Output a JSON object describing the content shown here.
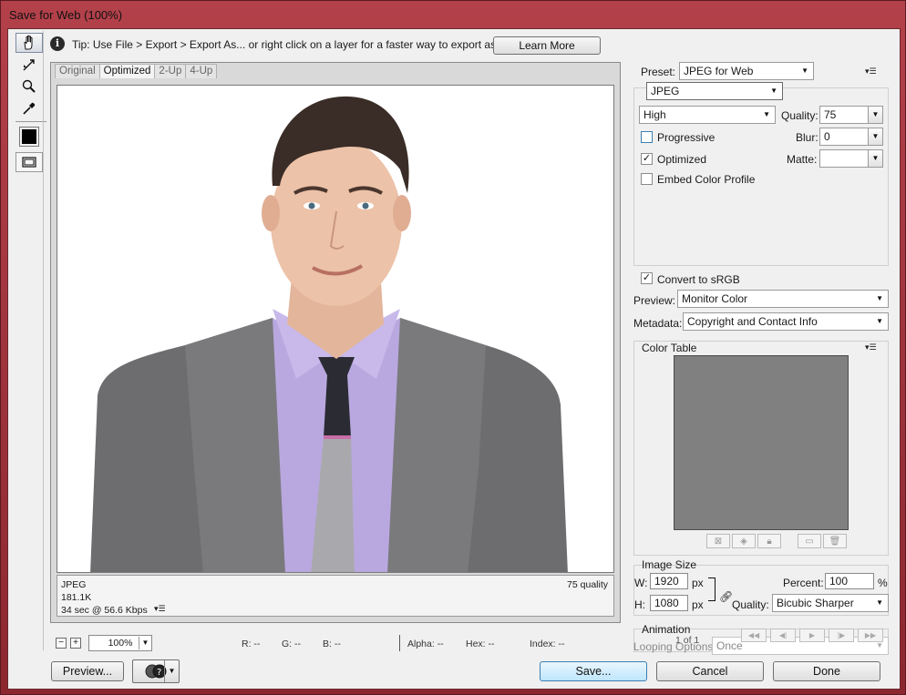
{
  "window": {
    "title": "Save for Web (100%)"
  },
  "tools": [
    {
      "name": "hand-tool",
      "icon": "hand-icon"
    },
    {
      "name": "slice-select-tool",
      "icon": "slice-select-icon"
    },
    {
      "name": "zoom-tool",
      "icon": "magnifier-icon"
    },
    {
      "name": "eyedropper-tool",
      "icon": "eyedropper-icon"
    },
    {
      "name": "toggle-slices",
      "icon": "slices-icon"
    }
  ],
  "tip": {
    "text": "Tip: Use File > Export > Export As...  or right click on a layer for a faster way to export assets",
    "learn_more": "Learn More"
  },
  "tabs": [
    "Original",
    "Optimized",
    "2-Up",
    "4-Up"
  ],
  "active_tab": "Optimized",
  "preview_info": {
    "format": "JPEG",
    "size": "181.1K",
    "download": "34 sec @ 56.6 Kbps",
    "quality": "75 quality"
  },
  "status": {
    "zoom": "100%",
    "r": "R: --",
    "g": "G: --",
    "b": "B: --",
    "alpha": "Alpha: --",
    "hex": "Hex: --",
    "index": "Index: --"
  },
  "buttons": {
    "preview": "Preview...",
    "save": "Save...",
    "cancel": "Cancel",
    "done": "Done"
  },
  "settings": {
    "preset_label": "Preset:",
    "preset_value": "JPEG for Web",
    "format": "JPEG",
    "quality_level": "High",
    "quality_label": "Quality:",
    "quality_value": "75",
    "progressive_label": "Progressive",
    "progressive_checked": false,
    "blur_label": "Blur:",
    "blur_value": "0",
    "optimized_label": "Optimized",
    "optimized_checked": true,
    "matte_label": "Matte:",
    "matte_value": "",
    "embed_profile_label": "Embed Color Profile",
    "embed_profile_checked": false,
    "convert_srgb_label": "Convert to sRGB",
    "convert_srgb_checked": true,
    "preview_label": "Preview:",
    "preview_value": "Monitor Color",
    "metadata_label": "Metadata:",
    "metadata_value": "Copyright and Contact Info"
  },
  "color_table": {
    "title": "Color Table"
  },
  "image_size": {
    "title": "Image Size",
    "w_label": "W:",
    "w_value": "1920",
    "h_label": "H:",
    "h_value": "1080",
    "unit": "px",
    "percent_label": "Percent:",
    "percent_value": "100",
    "percent_unit": "%",
    "quality_label": "Quality:",
    "quality_value": "Bicubic Sharper"
  },
  "animation": {
    "title": "Animation",
    "looping_label": "Looping Options:",
    "looping_value": "Once",
    "frame_counter": "1 of 1"
  },
  "colors": {
    "window_frame": "#9e3038",
    "client_bg": "#f0f0f0",
    "save_button": "#bee6fd",
    "color_table_fill": "#808080"
  }
}
